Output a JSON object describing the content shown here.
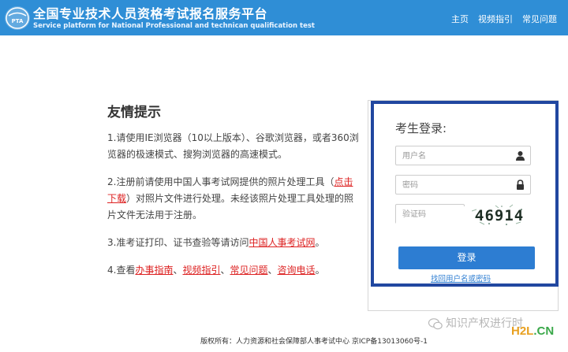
{
  "header": {
    "title_cn": "全国专业技术人员资格考试报名服务平台",
    "title_en": "Service platform for National Professional and technican qualification test",
    "logo_text": "PTA",
    "nav": [
      {
        "label": "主页"
      },
      {
        "label": "视频指引"
      },
      {
        "label": "常见问题"
      }
    ],
    "colors": {
      "bar": "#2f8ed6"
    }
  },
  "tips": {
    "title": "友情提示",
    "items": [
      {
        "text": "1.请使用IE浏览器（10以上版本）、谷歌浏览器，或者360浏览器的极速模式、搜狗浏览器的高速模式。"
      },
      {
        "pre": "2.注册前请使用中国人事考试网提供的照片处理工具（",
        "link": "点击下载",
        "post": "）对照片文件进行处理。未经该照片处理工具处理的照片文件无法用于注册。"
      },
      {
        "pre": "3.准考证打印、证书查验等请访问",
        "link": "中国人事考试网",
        "post": "。"
      },
      {
        "pre": "4.查看",
        "links": [
          "办事指南",
          "视频指引",
          "常见问题",
          "咨询电话"
        ],
        "sep": "、",
        "post": "。"
      }
    ]
  },
  "login": {
    "title": "考生登录:",
    "username_placeholder": "用户名",
    "password_placeholder": "密码",
    "captcha_placeholder": "验证码",
    "captcha_code": "46914",
    "button": "登录",
    "forgot": "找回用户名或密码",
    "colors": {
      "highlight_border": "#2147a0",
      "button": "#2d7dd2"
    }
  },
  "footer": {
    "text": "版权所有：人力资源和社会保障部人事考试中心 京ICP备13013060号-1"
  },
  "watermark": {
    "text": "知识产权进行时",
    "site_part1": "H2L",
    "site_part2": ".CN"
  }
}
